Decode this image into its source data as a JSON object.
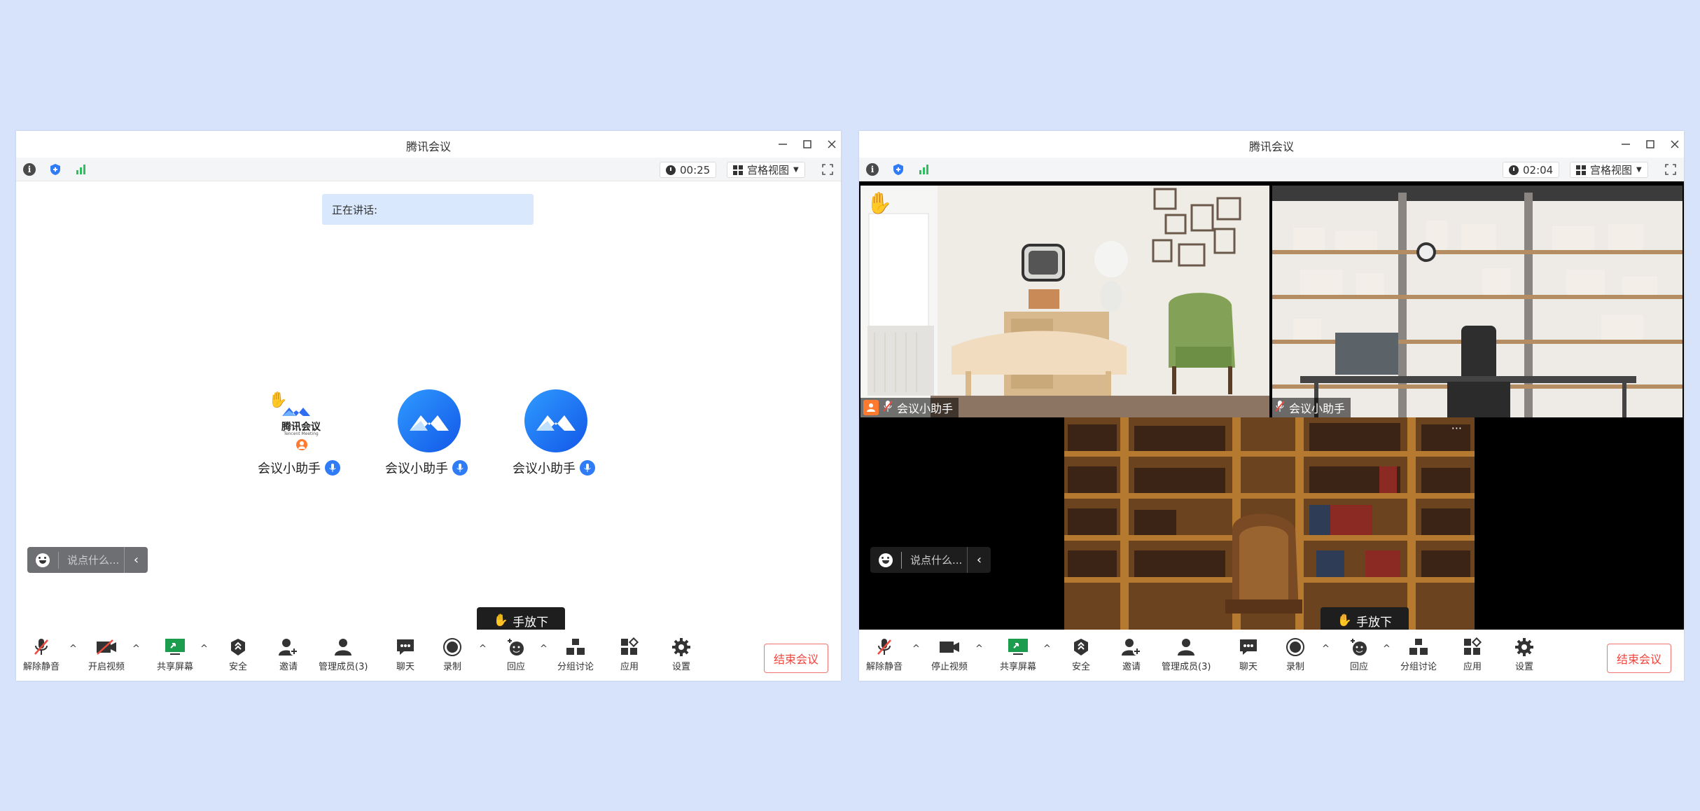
{
  "window_left": {
    "title": "腾讯会议",
    "timer": "00:25",
    "view_label": "宫格视图",
    "speaking_label": "正在讲话:",
    "logo_text": "腾讯会议",
    "logo_subtext": "Tencent Meeting",
    "participants": [
      "会议小助手",
      "会议小助手",
      "会议小助手"
    ],
    "chat_placeholder": "说点什么...",
    "hand_label": "手放下",
    "toolbar": [
      "解除静音",
      "开启视频",
      "共享屏幕",
      "安全",
      "邀请",
      "管理成员(3)",
      "聊天",
      "录制",
      "回应",
      "分组讨论",
      "应用",
      "设置"
    ],
    "end_label": "结束会议"
  },
  "window_right": {
    "title": "腾讯会议",
    "timer": "02:04",
    "view_label": "宫格视图",
    "video_labels": [
      "会议小助手",
      "会议小助手"
    ],
    "chat_placeholder": "说点什么...",
    "hand_label": "手放下",
    "toolbar": [
      "解除静音",
      "停止视频",
      "共享屏幕",
      "安全",
      "邀请",
      "管理成员(3)",
      "聊天",
      "录制",
      "回应",
      "分组讨论",
      "应用",
      "设置"
    ],
    "end_label": "结束会议"
  },
  "colors": {
    "accent": "#2f7cf6",
    "danger": "#f0443d",
    "page_bg": "#d7e3fb",
    "signal": "#2fbf5f"
  }
}
